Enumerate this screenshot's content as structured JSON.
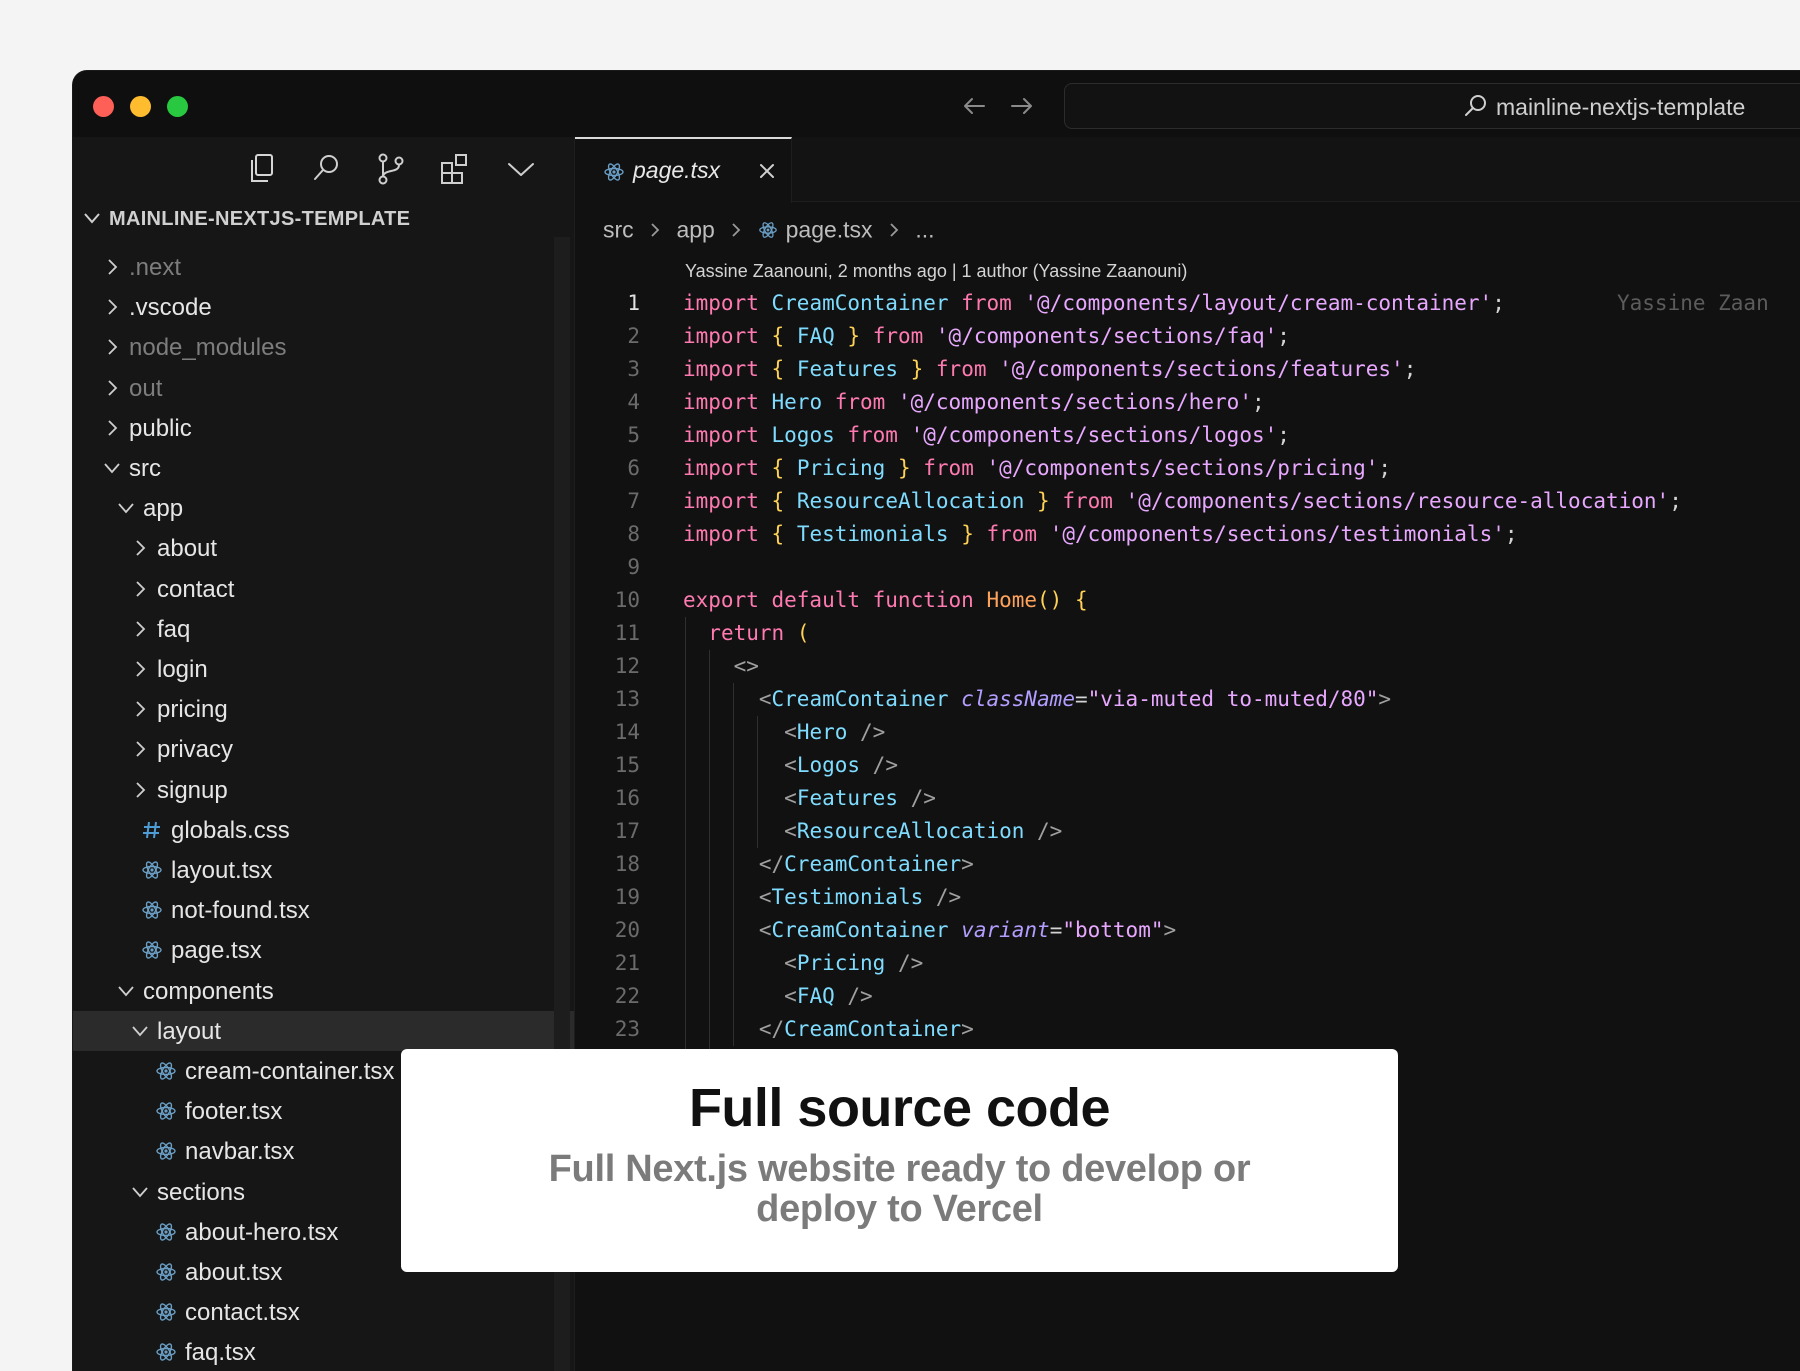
{
  "titlebar": {
    "search_text": "mainline-nextjs-template"
  },
  "sidebar": {
    "explorer_title": "MAINLINE-NEXTJS-TEMPLATE",
    "tree": [
      {
        "label": ".next",
        "type": "folder",
        "expanded": false,
        "depth": 0,
        "dim": true
      },
      {
        "label": ".vscode",
        "type": "folder",
        "expanded": false,
        "depth": 0
      },
      {
        "label": "node_modules",
        "type": "folder",
        "expanded": false,
        "depth": 0,
        "dim": true
      },
      {
        "label": "out",
        "type": "folder",
        "expanded": false,
        "depth": 0,
        "dim": true
      },
      {
        "label": "public",
        "type": "folder",
        "expanded": false,
        "depth": 0
      },
      {
        "label": "src",
        "type": "folder",
        "expanded": true,
        "depth": 0
      },
      {
        "label": "app",
        "type": "folder",
        "expanded": true,
        "depth": 1
      },
      {
        "label": "about",
        "type": "folder",
        "expanded": false,
        "depth": 2
      },
      {
        "label": "contact",
        "type": "folder",
        "expanded": false,
        "depth": 2
      },
      {
        "label": "faq",
        "type": "folder",
        "expanded": false,
        "depth": 2
      },
      {
        "label": "login",
        "type": "folder",
        "expanded": false,
        "depth": 2
      },
      {
        "label": "pricing",
        "type": "folder",
        "expanded": false,
        "depth": 2
      },
      {
        "label": "privacy",
        "type": "folder",
        "expanded": false,
        "depth": 2
      },
      {
        "label": "signup",
        "type": "folder",
        "expanded": false,
        "depth": 2
      },
      {
        "label": "globals.css",
        "type": "css",
        "depth": 2
      },
      {
        "label": "layout.tsx",
        "type": "react",
        "depth": 2
      },
      {
        "label": "not-found.tsx",
        "type": "react",
        "depth": 2
      },
      {
        "label": "page.tsx",
        "type": "react",
        "depth": 2
      },
      {
        "label": "components",
        "type": "folder",
        "expanded": true,
        "depth": 1
      },
      {
        "label": "layout",
        "type": "folder",
        "expanded": true,
        "depth": 2,
        "selected": true
      },
      {
        "label": "cream-container.tsx",
        "type": "react",
        "depth": 3
      },
      {
        "label": "footer.tsx",
        "type": "react",
        "depth": 3
      },
      {
        "label": "navbar.tsx",
        "type": "react",
        "depth": 3
      },
      {
        "label": "sections",
        "type": "folder",
        "expanded": true,
        "depth": 2
      },
      {
        "label": "about-hero.tsx",
        "type": "react",
        "depth": 3
      },
      {
        "label": "about.tsx",
        "type": "react",
        "depth": 3
      },
      {
        "label": "contact.tsx",
        "type": "react",
        "depth": 3
      },
      {
        "label": "faq.tsx",
        "type": "react",
        "depth": 3
      }
    ]
  },
  "editor": {
    "tab_label": "page.tsx",
    "breadcrumb": [
      "src",
      "app",
      "page.tsx",
      "..."
    ],
    "blame_header": "Yassine Zaanouni, 2 months ago | 1 author (Yassine Zaanouni)",
    "inline_blame": "Yassine Zaan",
    "current_line": 1,
    "lines": [
      [
        [
          "kw",
          "import "
        ],
        [
          "id",
          "CreamContainer "
        ],
        [
          "kw",
          "from "
        ],
        [
          "str",
          "'@/components/layout/cream-container'"
        ],
        [
          "punc",
          ";"
        ]
      ],
      [
        [
          "kw",
          "import "
        ],
        [
          "brace",
          "{ "
        ],
        [
          "id",
          "FAQ "
        ],
        [
          "brace",
          "} "
        ],
        [
          "kw",
          "from "
        ],
        [
          "str",
          "'@/components/sections/faq'"
        ],
        [
          "punc",
          ";"
        ]
      ],
      [
        [
          "kw",
          "import "
        ],
        [
          "brace",
          "{ "
        ],
        [
          "id",
          "Features "
        ],
        [
          "brace",
          "} "
        ],
        [
          "kw",
          "from "
        ],
        [
          "str",
          "'@/components/sections/features'"
        ],
        [
          "punc",
          ";"
        ]
      ],
      [
        [
          "kw",
          "import "
        ],
        [
          "id",
          "Hero "
        ],
        [
          "kw",
          "from "
        ],
        [
          "str",
          "'@/components/sections/hero'"
        ],
        [
          "punc",
          ";"
        ]
      ],
      [
        [
          "kw",
          "import "
        ],
        [
          "id",
          "Logos "
        ],
        [
          "kw",
          "from "
        ],
        [
          "str",
          "'@/components/sections/logos'"
        ],
        [
          "punc",
          ";"
        ]
      ],
      [
        [
          "kw",
          "import "
        ],
        [
          "brace",
          "{ "
        ],
        [
          "id",
          "Pricing "
        ],
        [
          "brace",
          "} "
        ],
        [
          "kw",
          "from "
        ],
        [
          "str",
          "'@/components/sections/pricing'"
        ],
        [
          "punc",
          ";"
        ]
      ],
      [
        [
          "kw",
          "import "
        ],
        [
          "brace",
          "{ "
        ],
        [
          "id",
          "ResourceAllocation "
        ],
        [
          "brace",
          "} "
        ],
        [
          "kw",
          "from "
        ],
        [
          "str",
          "'@/components/sections/resource-allocation'"
        ],
        [
          "punc",
          ";"
        ]
      ],
      [
        [
          "kw",
          "import "
        ],
        [
          "brace",
          "{ "
        ],
        [
          "id",
          "Testimonials "
        ],
        [
          "brace",
          "} "
        ],
        [
          "kw",
          "from "
        ],
        [
          "str",
          "'@/components/sections/testimonials'"
        ],
        [
          "punc",
          ";"
        ]
      ],
      [],
      [
        [
          "kw",
          "export default function "
        ],
        [
          "fn",
          "Home"
        ],
        [
          "paren",
          "() {"
        ]
      ],
      [
        [
          "plain",
          "  "
        ],
        [
          "kw",
          "return "
        ],
        [
          "paren",
          "("
        ]
      ],
      [
        [
          "plain",
          "    "
        ],
        [
          "ang",
          "<>"
        ]
      ],
      [
        [
          "plain",
          "      "
        ],
        [
          "ang",
          "<"
        ],
        [
          "tag",
          "CreamContainer "
        ],
        [
          "attr",
          "className"
        ],
        [
          "plain",
          "="
        ],
        [
          "str",
          "\"via-muted to-muted/80\""
        ],
        [
          "ang",
          ">"
        ]
      ],
      [
        [
          "plain",
          "        "
        ],
        [
          "ang",
          "<"
        ],
        [
          "tag",
          "Hero "
        ],
        [
          "ang",
          "/>"
        ]
      ],
      [
        [
          "plain",
          "        "
        ],
        [
          "ang",
          "<"
        ],
        [
          "tag",
          "Logos "
        ],
        [
          "ang",
          "/>"
        ]
      ],
      [
        [
          "plain",
          "        "
        ],
        [
          "ang",
          "<"
        ],
        [
          "tag",
          "Features "
        ],
        [
          "ang",
          "/>"
        ]
      ],
      [
        [
          "plain",
          "        "
        ],
        [
          "ang",
          "<"
        ],
        [
          "tag",
          "ResourceAllocation "
        ],
        [
          "ang",
          "/>"
        ]
      ],
      [
        [
          "plain",
          "      "
        ],
        [
          "ang",
          "</"
        ],
        [
          "tag",
          "CreamContainer"
        ],
        [
          "ang",
          ">"
        ]
      ],
      [
        [
          "plain",
          "      "
        ],
        [
          "ang",
          "<"
        ],
        [
          "tag",
          "Testimonials "
        ],
        [
          "ang",
          "/>"
        ]
      ],
      [
        [
          "plain",
          "      "
        ],
        [
          "ang",
          "<"
        ],
        [
          "tag",
          "CreamContainer "
        ],
        [
          "attr",
          "variant"
        ],
        [
          "plain",
          "="
        ],
        [
          "str",
          "\"bottom\""
        ],
        [
          "ang",
          ">"
        ]
      ],
      [
        [
          "plain",
          "        "
        ],
        [
          "ang",
          "<"
        ],
        [
          "tag",
          "Pricing "
        ],
        [
          "ang",
          "/>"
        ]
      ],
      [
        [
          "plain",
          "        "
        ],
        [
          "ang",
          "<"
        ],
        [
          "tag",
          "FAQ "
        ],
        [
          "ang",
          "/>"
        ]
      ],
      [
        [
          "plain",
          "      "
        ],
        [
          "ang",
          "</"
        ],
        [
          "tag",
          "CreamContainer"
        ],
        [
          "ang",
          ">"
        ]
      ],
      [
        [
          "plain",
          "    "
        ],
        [
          "ang",
          "</>"
        ]
      ]
    ]
  },
  "card": {
    "heading": "Full source code",
    "subtitle": "Full Next.js website ready to develop or deploy to Vercel"
  }
}
